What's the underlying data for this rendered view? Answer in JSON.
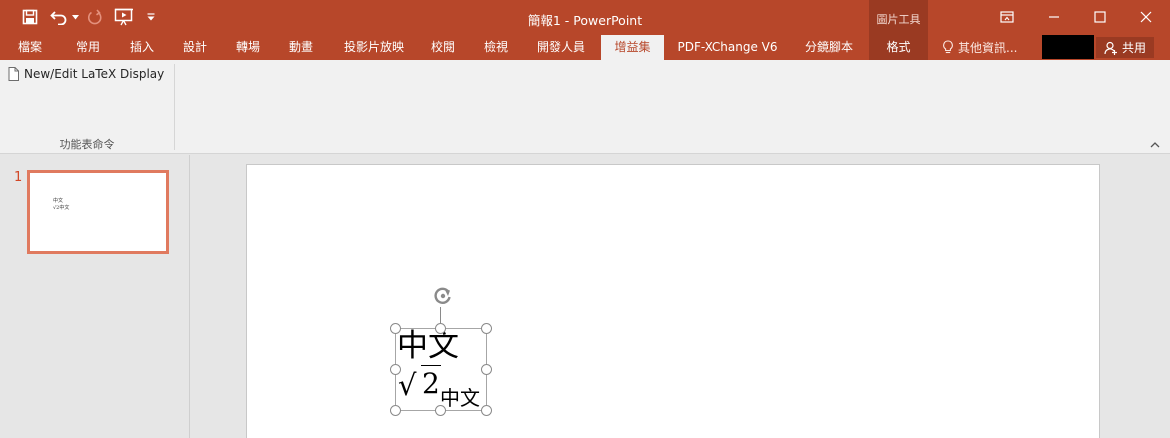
{
  "window": {
    "title": "簡報1 - PowerPoint",
    "context_group": "圖片工具"
  },
  "quick_access": {
    "icons": [
      "save-icon",
      "undo-icon",
      "undo-dropdown-icon",
      "redo-icon",
      "slideshow-from-beginning-icon",
      "customize-toolbar-icon"
    ]
  },
  "ribbon_tabs": [
    {
      "label": "檔案"
    },
    {
      "label": "常用"
    },
    {
      "label": "插入"
    },
    {
      "label": "設計"
    },
    {
      "label": "轉場"
    },
    {
      "label": "動畫"
    },
    {
      "label": "投影片放映"
    },
    {
      "label": "校閱"
    },
    {
      "label": "檢視"
    },
    {
      "label": "開發人員"
    },
    {
      "label": "增益集",
      "active": true
    },
    {
      "label": "PDF-XChange V6"
    },
    {
      "label": "分鏡腳本"
    },
    {
      "label": "格式",
      "contextual": true
    }
  ],
  "tell_me": "其他資訊...",
  "share": "共用",
  "ribbon": {
    "latex_button": "New/Edit LaTeX Display",
    "group_label": "功能表命令"
  },
  "slides_pane": {
    "slide_number": "1",
    "thumb_text_line1": "中文",
    "thumb_text_line2": "√2中文"
  },
  "slide": {
    "equation": {
      "line1": "中文",
      "radicand": "2",
      "subscript": "中文"
    }
  },
  "colors": {
    "accent": "#b7472a",
    "contextual_tab": "#9a3a22",
    "ribbon_bg": "#f1f1f1",
    "workspace_bg": "#e6e6e6",
    "thumbnail_selected_border": "#e07a5f"
  }
}
